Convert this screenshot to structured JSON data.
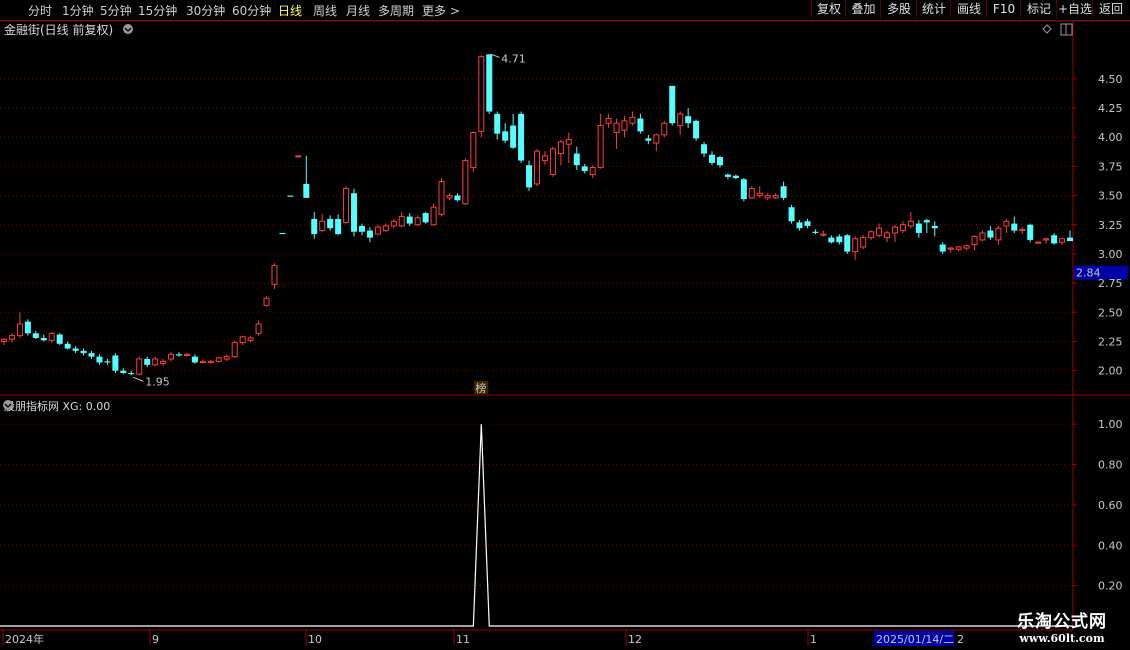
{
  "toolbar": {
    "tabs": [
      "分时",
      "1分钟",
      "5分钟",
      "15分钟",
      "30分钟",
      "60分钟",
      "日线",
      "周线",
      "月线",
      "多周期",
      "更多 >"
    ],
    "active_tab": "日线",
    "buttons": [
      "复权",
      "叠加",
      "多股",
      "统计",
      "画线",
      "F10",
      "标记",
      "+自选",
      "返回"
    ]
  },
  "main_panel": {
    "title": "金融街(日线 前复权)"
  },
  "indicator_panel": {
    "title": "股朋指标网 XG: 0.00"
  },
  "time_axis": {
    "labels": [
      "2024年",
      "9",
      "10",
      "11",
      "12",
      "1"
    ],
    "cursor_date": "2025/01/14/二",
    "cursor_tail": "2"
  },
  "marker_label": "榜",
  "watermark": {
    "line1": "乐淘公式网",
    "line2": "www.60lt.com"
  },
  "colors": {
    "up": "#ff3c3c",
    "down": "#54ffff",
    "axis": "#a00000",
    "grid": "#7a0000",
    "highlight_box": "#0000a8"
  },
  "chart_data": [
    {
      "type": "candlestick",
      "title": "金融街(日线 前复权)",
      "ylim": [
        1.8,
        4.85
      ],
      "yticks": [
        2.0,
        2.25,
        2.5,
        2.75,
        3.0,
        3.25,
        3.5,
        3.75,
        4.0,
        4.25,
        4.5
      ],
      "current_price": "2.84",
      "annotations": [
        {
          "text": "4.71",
          "type": "high"
        },
        {
          "text": "1.95",
          "type": "low"
        }
      ],
      "ohlc": [
        [
          2.25,
          2.28,
          2.22,
          2.27
        ],
        [
          2.27,
          2.32,
          2.24,
          2.3
        ],
        [
          2.3,
          2.5,
          2.28,
          2.4
        ],
        [
          2.42,
          2.44,
          2.3,
          2.32
        ],
        [
          2.32,
          2.34,
          2.27,
          2.28
        ],
        [
          2.28,
          2.31,
          2.25,
          2.26
        ],
        [
          2.26,
          2.33,
          2.24,
          2.32
        ],
        [
          2.31,
          2.32,
          2.22,
          2.23
        ],
        [
          2.23,
          2.25,
          2.18,
          2.19
        ],
        [
          2.19,
          2.21,
          2.15,
          2.17
        ],
        [
          2.17,
          2.19,
          2.13,
          2.15
        ],
        [
          2.15,
          2.17,
          2.1,
          2.12
        ],
        [
          2.12,
          2.14,
          2.05,
          2.07
        ],
        [
          2.08,
          2.1,
          2.05,
          2.07
        ],
        [
          2.13,
          2.15,
          1.98,
          2.0
        ],
        [
          2.0,
          2.02,
          1.97,
          1.98
        ],
        [
          1.98,
          2.0,
          1.96,
          1.97
        ],
        [
          1.97,
          2.12,
          1.96,
          2.1
        ],
        [
          2.1,
          2.12,
          2.03,
          2.05
        ],
        [
          2.05,
          2.12,
          2.04,
          2.1
        ],
        [
          2.06,
          2.1,
          2.04,
          2.08
        ],
        [
          2.1,
          2.16,
          2.08,
          2.14
        ],
        [
          2.14,
          2.16,
          2.12,
          2.13
        ],
        [
          2.13,
          2.15,
          2.12,
          2.14
        ],
        [
          2.12,
          2.14,
          2.06,
          2.07
        ],
        [
          2.07,
          2.09,
          2.06,
          2.08
        ],
        [
          2.07,
          2.09,
          2.06,
          2.08
        ],
        [
          2.08,
          2.12,
          2.07,
          2.11
        ],
        [
          2.1,
          2.14,
          2.08,
          2.12
        ],
        [
          2.12,
          2.26,
          2.11,
          2.24
        ],
        [
          2.24,
          2.3,
          2.22,
          2.29
        ],
        [
          2.26,
          2.3,
          2.24,
          2.28
        ],
        [
          2.32,
          2.43,
          2.3,
          2.4
        ],
        [
          2.56,
          2.64,
          2.55,
          2.62
        ],
        [
          2.74,
          2.92,
          2.7,
          2.9
        ],
        [
          3.18,
          3.18,
          3.17,
          3.17
        ],
        [
          3.5,
          3.5,
          3.49,
          3.49
        ],
        [
          3.84,
          3.84,
          3.84,
          3.84
        ],
        [
          3.6,
          3.84,
          3.48,
          3.48
        ],
        [
          3.3,
          3.36,
          3.13,
          3.17
        ],
        [
          3.2,
          3.34,
          3.19,
          3.28
        ],
        [
          3.3,
          3.33,
          3.2,
          3.22
        ],
        [
          3.3,
          3.34,
          3.16,
          3.17
        ],
        [
          3.27,
          3.58,
          3.26,
          3.56
        ],
        [
          3.52,
          3.56,
          3.15,
          3.19
        ],
        [
          3.24,
          3.26,
          3.16,
          3.19
        ],
        [
          3.2,
          3.23,
          3.1,
          3.14
        ],
        [
          3.17,
          3.25,
          3.16,
          3.23
        ],
        [
          3.2,
          3.26,
          3.19,
          3.24
        ],
        [
          3.24,
          3.3,
          3.22,
          3.28
        ],
        [
          3.24,
          3.36,
          3.23,
          3.32
        ],
        [
          3.32,
          3.35,
          3.24,
          3.26
        ],
        [
          3.25,
          3.33,
          3.24,
          3.31
        ],
        [
          3.35,
          3.36,
          3.26,
          3.27
        ],
        [
          3.25,
          3.43,
          3.24,
          3.4
        ],
        [
          3.34,
          3.65,
          3.32,
          3.62
        ],
        [
          3.48,
          3.52,
          3.46,
          3.5
        ],
        [
          3.5,
          3.52,
          3.45,
          3.46
        ],
        [
          3.43,
          3.82,
          3.42,
          3.8
        ],
        [
          3.74,
          4.05,
          3.7,
          4.04
        ],
        [
          4.05,
          4.7,
          4.0,
          4.69
        ],
        [
          4.71,
          4.71,
          4.2,
          4.22
        ],
        [
          4.2,
          4.22,
          3.98,
          4.03
        ],
        [
          4.05,
          4.12,
          3.95,
          3.97
        ],
        [
          4.1,
          4.2,
          3.9,
          3.91
        ],
        [
          4.2,
          4.22,
          3.78,
          3.8
        ],
        [
          3.76,
          3.8,
          3.54,
          3.57
        ],
        [
          3.6,
          3.9,
          3.58,
          3.88
        ],
        [
          3.8,
          3.88,
          3.76,
          3.84
        ],
        [
          3.68,
          3.92,
          3.66,
          3.9
        ],
        [
          3.86,
          3.98,
          3.76,
          3.96
        ],
        [
          3.94,
          4.04,
          3.78,
          3.98
        ],
        [
          3.86,
          3.92,
          3.72,
          3.76
        ],
        [
          3.75,
          3.77,
          3.69,
          3.71
        ],
        [
          3.68,
          3.76,
          3.65,
          3.74
        ],
        [
          3.74,
          4.2,
          3.73,
          4.1
        ],
        [
          4.12,
          4.2,
          4.08,
          4.16
        ],
        [
          4.04,
          4.16,
          3.9,
          4.12
        ],
        [
          4.06,
          4.18,
          4.0,
          4.14
        ],
        [
          4.12,
          4.22,
          4.1,
          4.17
        ],
        [
          4.16,
          4.2,
          4.03,
          4.05
        ],
        [
          3.99,
          4.02,
          3.94,
          3.97
        ],
        [
          3.95,
          4.03,
          3.88,
          4.02
        ],
        [
          4.02,
          4.14,
          4.0,
          4.12
        ],
        [
          4.44,
          4.44,
          4.1,
          4.12
        ],
        [
          4.1,
          4.22,
          4.02,
          4.2
        ],
        [
          4.18,
          4.25,
          4.08,
          4.12
        ],
        [
          4.14,
          4.15,
          3.97,
          3.99
        ],
        [
          3.94,
          3.96,
          3.83,
          3.86
        ],
        [
          3.85,
          3.88,
          3.76,
          3.78
        ],
        [
          3.83,
          3.84,
          3.74,
          3.76
        ],
        [
          3.68,
          3.69,
          3.64,
          3.66
        ],
        [
          3.67,
          3.68,
          3.64,
          3.65
        ],
        [
          3.64,
          3.65,
          3.45,
          3.47
        ],
        [
          3.48,
          3.58,
          3.47,
          3.56
        ],
        [
          3.5,
          3.58,
          3.48,
          3.52
        ],
        [
          3.48,
          3.52,
          3.46,
          3.5
        ],
        [
          3.48,
          3.52,
          3.47,
          3.5
        ],
        [
          3.58,
          3.62,
          3.46,
          3.48
        ],
        [
          3.4,
          3.42,
          3.26,
          3.28
        ],
        [
          3.27,
          3.29,
          3.2,
          3.22
        ],
        [
          3.28,
          3.3,
          3.22,
          3.24
        ],
        [
          3.19,
          3.21,
          3.17,
          3.18
        ],
        [
          3.16,
          3.2,
          3.15,
          3.17
        ],
        [
          3.14,
          3.16,
          3.09,
          3.1
        ],
        [
          3.15,
          3.17,
          3.08,
          3.1
        ],
        [
          3.16,
          3.17,
          3.0,
          3.02
        ],
        [
          3.02,
          3.15,
          2.95,
          3.13
        ],
        [
          3.06,
          3.16,
          3.04,
          3.14
        ],
        [
          3.14,
          3.2,
          3.12,
          3.19
        ],
        [
          3.16,
          3.26,
          3.14,
          3.22
        ],
        [
          3.14,
          3.2,
          3.1,
          3.18
        ],
        [
          3.18,
          3.25,
          3.1,
          3.23
        ],
        [
          3.2,
          3.28,
          3.18,
          3.25
        ],
        [
          3.24,
          3.36,
          3.22,
          3.28
        ],
        [
          3.26,
          3.29,
          3.14,
          3.18
        ],
        [
          3.29,
          3.3,
          3.18,
          3.27
        ],
        [
          3.24,
          3.28,
          3.15,
          3.22
        ],
        [
          3.08,
          3.1,
          3.0,
          3.02
        ],
        [
          3.04,
          3.06,
          3.01,
          3.05
        ],
        [
          3.04,
          3.07,
          3.02,
          3.06
        ],
        [
          3.05,
          3.08,
          3.03,
          3.07
        ],
        [
          3.08,
          3.16,
          3.03,
          3.15
        ],
        [
          3.12,
          3.2,
          3.11,
          3.18
        ],
        [
          3.2,
          3.24,
          3.12,
          3.14
        ],
        [
          3.12,
          3.24,
          3.08,
          3.22
        ],
        [
          3.24,
          3.3,
          3.18,
          3.28
        ],
        [
          3.26,
          3.32,
          3.18,
          3.2
        ],
        [
          3.2,
          3.23,
          3.17,
          3.21
        ],
        [
          3.25,
          3.26,
          3.1,
          3.12
        ],
        [
          3.1,
          3.11,
          3.09,
          3.1
        ],
        [
          3.12,
          3.14,
          3.09,
          3.13
        ],
        [
          3.16,
          3.18,
          3.08,
          3.09
        ],
        [
          3.1,
          3.14,
          3.08,
          3.13
        ],
        [
          3.14,
          3.2,
          3.12,
          3.11
        ]
      ]
    },
    {
      "type": "line",
      "title": "股朋指标网 XG: 0.00",
      "ylim": [
        0.0,
        1.08
      ],
      "yticks": [
        0.2,
        0.4,
        0.6,
        0.8,
        1.0
      ],
      "series": [
        {
          "name": "XG",
          "spike_index": 60,
          "spike_value": 1.0,
          "base_value": 0.0
        }
      ]
    }
  ]
}
